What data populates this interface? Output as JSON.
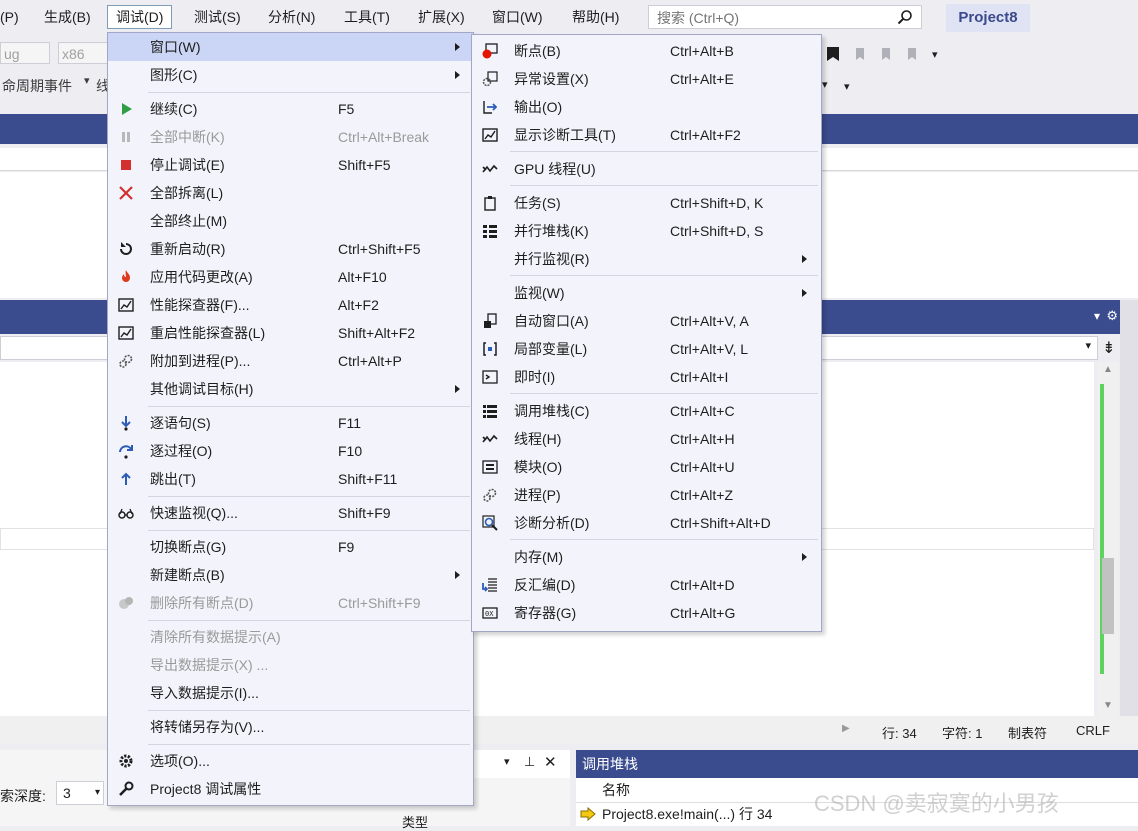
{
  "menubar": {
    "items": [
      "(P)",
      "生成(B)",
      "调试(D)",
      "测试(S)",
      "分析(N)",
      "工具(T)",
      "扩展(X)",
      "窗口(W)",
      "帮助(H)"
    ],
    "search_placeholder": "搜索 (Ctrl+Q)",
    "project_badge": "Project8"
  },
  "toolbar": {
    "config_combo": "ug",
    "platform_combo": "x86",
    "lifecycle_label": "命周期事件",
    "extra_char": "线"
  },
  "debug_menu": {
    "items": [
      {
        "label": "窗口(W)",
        "shortcut": "",
        "submenu": true,
        "icon": "none",
        "disabled": false,
        "highlighted": true
      },
      {
        "label": "图形(C)",
        "shortcut": "",
        "submenu": true,
        "icon": "none",
        "disabled": false
      },
      {
        "label": "继续(C)",
        "shortcut": "F5",
        "icon": "play-icon",
        "disabled": false
      },
      {
        "label": "全部中断(K)",
        "shortcut": "Ctrl+Alt+Break",
        "icon": "pause-icon",
        "disabled": true
      },
      {
        "label": "停止调试(E)",
        "shortcut": "Shift+F5",
        "icon": "stop-icon",
        "disabled": false
      },
      {
        "label": "全部拆离(L)",
        "shortcut": "",
        "icon": "close-icon",
        "disabled": false
      },
      {
        "label": "全部终止(M)",
        "shortcut": "",
        "icon": "none",
        "disabled": false
      },
      {
        "label": "重新启动(R)",
        "shortcut": "Ctrl+Shift+F5",
        "icon": "restart-icon",
        "disabled": false
      },
      {
        "label": "应用代码更改(A)",
        "shortcut": "Alt+F10",
        "icon": "flame-icon",
        "disabled": false
      },
      {
        "label": "性能探查器(F)...",
        "shortcut": "Alt+F2",
        "icon": "chart-icon",
        "disabled": false
      },
      {
        "label": "重启性能探查器(L)",
        "shortcut": "Shift+Alt+F2",
        "icon": "chart-icon",
        "disabled": false
      },
      {
        "label": "附加到进程(P)...",
        "shortcut": "Ctrl+Alt+P",
        "icon": "gears-icon",
        "disabled": false
      },
      {
        "label": "其他调试目标(H)",
        "shortcut": "",
        "submenu": true,
        "icon": "none",
        "disabled": false
      },
      {
        "label": "逐语句(S)",
        "shortcut": "F11",
        "icon": "step-into-icon",
        "disabled": false
      },
      {
        "label": "逐过程(O)",
        "shortcut": "F10",
        "icon": "step-over-icon",
        "disabled": false
      },
      {
        "label": "跳出(T)",
        "shortcut": "Shift+F11",
        "icon": "step-out-icon",
        "disabled": false
      },
      {
        "label": "快速监视(Q)...",
        "shortcut": "Shift+F9",
        "icon": "glasses-icon",
        "disabled": false
      },
      {
        "label": "切换断点(G)",
        "shortcut": "F9",
        "icon": "none",
        "disabled": false
      },
      {
        "label": "新建断点(B)",
        "shortcut": "",
        "submenu": true,
        "icon": "none",
        "disabled": false
      },
      {
        "label": "删除所有断点(D)",
        "shortcut": "Ctrl+Shift+F9",
        "icon": "delete-breakpoints-icon",
        "disabled": true
      },
      {
        "label": "清除所有数据提示(A)",
        "shortcut": "",
        "icon": "none",
        "disabled": true
      },
      {
        "label": "导出数据提示(X) ...",
        "shortcut": "",
        "icon": "none",
        "disabled": true
      },
      {
        "label": "导入数据提示(I)...",
        "shortcut": "",
        "icon": "none",
        "disabled": false
      },
      {
        "label": "将转储另存为(V)...",
        "shortcut": "",
        "icon": "none",
        "disabled": true
      },
      {
        "label": "选项(O)...",
        "shortcut": "",
        "icon": "gear-icon",
        "disabled": false
      },
      {
        "label": "Project8 调试属性",
        "shortcut": "",
        "icon": "wrench-icon",
        "disabled": false
      }
    ]
  },
  "window_menu": {
    "items": [
      {
        "label": "断点(B)",
        "shortcut": "Ctrl+Alt+B",
        "icon": "breakpoint-icon"
      },
      {
        "label": "异常设置(X)",
        "shortcut": "Ctrl+Alt+E",
        "icon": "exception-icon"
      },
      {
        "label": "输出(O)",
        "shortcut": "",
        "icon": "output-icon"
      },
      {
        "label": "显示诊断工具(T)",
        "shortcut": "Ctrl+Alt+F2",
        "icon": "diagnostics-icon"
      },
      {
        "label": "GPU 线程(U)",
        "shortcut": "",
        "icon": "threads-icon"
      },
      {
        "label": "任务(S)",
        "shortcut": "Ctrl+Shift+D, K",
        "icon": "tasks-icon"
      },
      {
        "label": "并行堆栈(K)",
        "shortcut": "Ctrl+Shift+D, S",
        "icon": "parallel-stacks-icon"
      },
      {
        "label": "并行监视(R)",
        "shortcut": "",
        "submenu": true,
        "icon": "none"
      },
      {
        "label": "监视(W)",
        "shortcut": "",
        "submenu": true,
        "icon": "none"
      },
      {
        "label": "自动窗口(A)",
        "shortcut": "Ctrl+Alt+V, A",
        "icon": "autos-icon"
      },
      {
        "label": "局部变量(L)",
        "shortcut": "Ctrl+Alt+V, L",
        "icon": "locals-icon"
      },
      {
        "label": "即时(I)",
        "shortcut": "Ctrl+Alt+I",
        "icon": "immediate-icon"
      },
      {
        "label": "调用堆栈(C)",
        "shortcut": "Ctrl+Alt+C",
        "icon": "call-stack-icon"
      },
      {
        "label": "线程(H)",
        "shortcut": "Ctrl+Alt+H",
        "icon": "threads-icon"
      },
      {
        "label": "模块(O)",
        "shortcut": "Ctrl+Alt+U",
        "icon": "modules-icon"
      },
      {
        "label": "进程(P)",
        "shortcut": "Ctrl+Alt+Z",
        "icon": "gears-icon"
      },
      {
        "label": "诊断分析(D)",
        "shortcut": "Ctrl+Shift+Alt+D",
        "icon": "analysis-icon"
      },
      {
        "label": "内存(M)",
        "shortcut": "",
        "submenu": true,
        "icon": "none"
      },
      {
        "label": "反汇编(D)",
        "shortcut": "Ctrl+Alt+D",
        "icon": "disassembly-icon"
      },
      {
        "label": "寄存器(G)",
        "shortcut": "Ctrl+Alt+G",
        "icon": "registers-icon"
      }
    ]
  },
  "status": {
    "line": "行: 34",
    "char": "字符: 1",
    "tabs": "制表符",
    "eol": "CRLF"
  },
  "bottom": {
    "depth_label": "索深度:",
    "depth_value": "3",
    "type_label": "类型"
  },
  "callstack": {
    "title": "调用堆栈",
    "column": "名称",
    "row": "Project8.exe!main(...) 行 34"
  },
  "watermark": "CSDN @卖寂寞的小男孩"
}
